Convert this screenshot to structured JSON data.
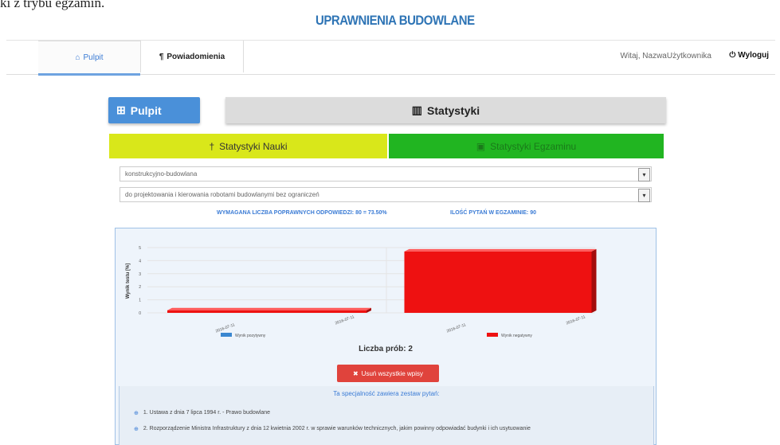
{
  "header": {
    "caption": "ki z trybu egzamin.",
    "brand": "UPRAWNIENIA BUDOWLANE"
  },
  "nav": {
    "tabs": [
      {
        "label": "Pulpit",
        "icon": "home-icon"
      },
      {
        "label": "Powiadomienia",
        "icon": "bell-icon"
      }
    ],
    "greeting": "Witaj, NazwaUżytkownika",
    "logout_label": "Wyloguj"
  },
  "main": {
    "pulpit_label": "Pulpit",
    "stats_label": "Statystyki",
    "tab_nauki": "Statystyki Nauki",
    "tab_egzaminu": "Statystyki Egzaminu",
    "select_specialty": "konstrukcyjno-budowlana",
    "select_scope": "do projektowania i kierowania robotami budowlanymi bez ograniczeń",
    "info_required": "WYMAGANA LICZBA POPRAWNYCH ODPOWIEDZI: 80 = 73.50%",
    "info_total": "ILOŚĆ PYTAŃ W EGZAMINIE: 90",
    "tries_label": "Liczba prób: 2",
    "delete_label": "Usuń wszystkie wpisy",
    "specs_heading": "Ta specjalność zawiera zestaw pytań:",
    "specs": [
      "1. Ustawa z dnia 7 lipca 1994 r. - Prawo budowlane",
      "2. Rozporządzenie Ministra Infrastruktury z dnia 12 kwietnia 2002 r. w sprawie warunków technicznych, jakim powinny odpowiadać budynki i ich usytuowanie"
    ]
  },
  "chart_data": {
    "type": "bar",
    "ylabel": "Wynik testu [%]",
    "yticks": [
      "5",
      "4",
      "3",
      "2",
      "1",
      "0"
    ],
    "categories": [
      "2016-07-11",
      "2016-07-11"
    ],
    "series": [
      {
        "name": "Wynik pozytywny",
        "color": "#3a87d0",
        "values": [
          0,
          0
        ]
      },
      {
        "name": "Wynik negatywny",
        "color": "#ee1111",
        "values": [
          0.2,
          4.7
        ]
      }
    ],
    "ylim": [
      0,
      5
    ],
    "legend": "bottom"
  },
  "colors": {
    "accent": "#4a90d9",
    "nauki": "#d9e71a",
    "egzamin": "#21b521",
    "danger": "#e0433c"
  }
}
